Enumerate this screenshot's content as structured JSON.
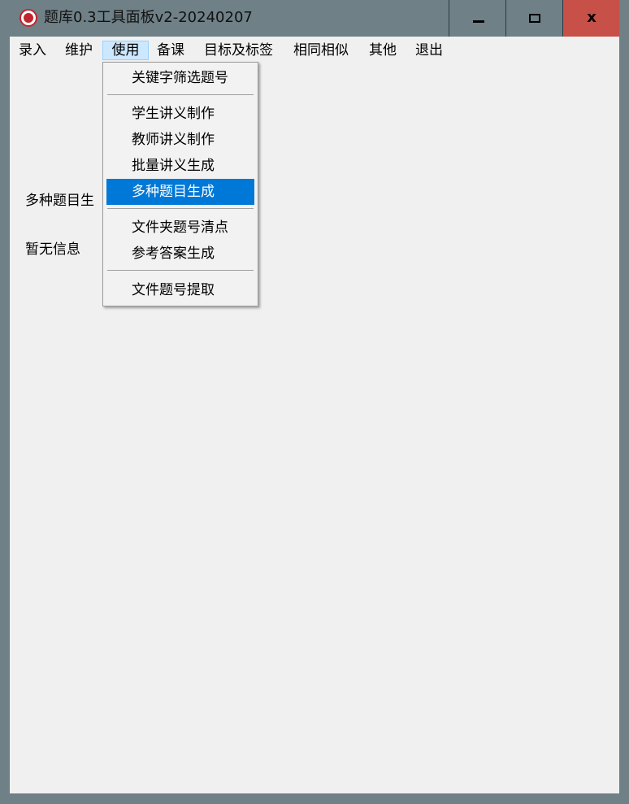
{
  "window": {
    "title": "题库0.3工具面板v2-20240207",
    "close_glyph": "x"
  },
  "menubar": {
    "items": [
      "录入",
      "维护",
      "使用",
      "备课",
      "目标及标签",
      "相同相似",
      "其他",
      "退出"
    ],
    "active_index": 2
  },
  "dropdown": {
    "items": [
      "关键字筛选题号",
      "学生讲义制作",
      "教师讲义制作",
      "批量讲义生成",
      "多种题目生成",
      "文件夹题号清点",
      "参考答案生成",
      "文件题号提取"
    ],
    "highlighted": "多种题目生成"
  },
  "content": {
    "generate_label": "多种题目生",
    "info_label": "暂无信息"
  },
  "colors": {
    "frame": "#6f8087",
    "close_button": "#c75048",
    "highlight": "#0078d7",
    "active_menu": "#cce8ff"
  }
}
